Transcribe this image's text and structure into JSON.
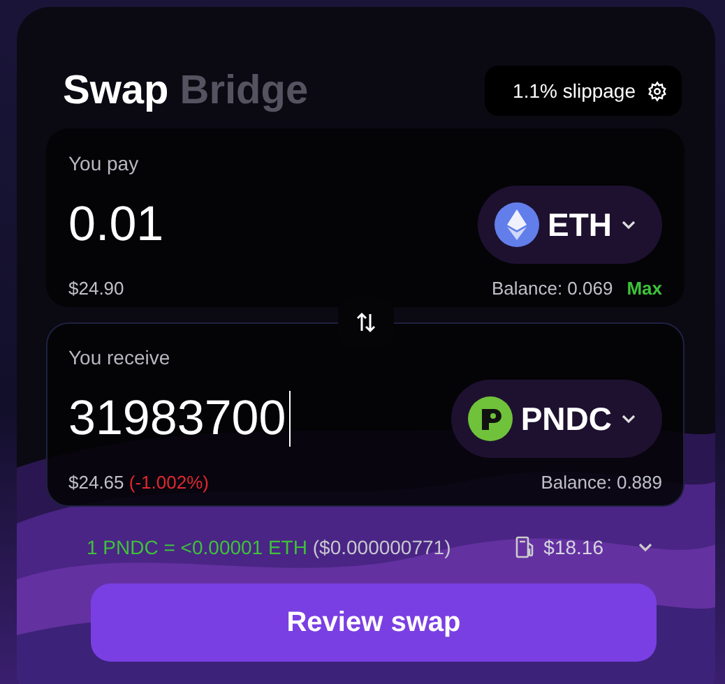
{
  "tabs": [
    {
      "label": "Swap",
      "selected": true
    },
    {
      "label": "Bridge",
      "selected": false
    }
  ],
  "slippage": {
    "label": "1.1% slippage"
  },
  "pay": {
    "label": "You pay",
    "amount": "0.01",
    "focused": false,
    "token": "ETH",
    "kind": "eth",
    "usd": "$24.90",
    "balance": "Balance: 0.069",
    "max": "Max"
  },
  "receive": {
    "label": "You receive",
    "amount": "31983700",
    "focused": true,
    "token": "PNDC",
    "kind": "pndc",
    "usd": "$24.65",
    "change": "(-1.002%)",
    "balance": "Balance: 0.889"
  },
  "rate": {
    "text": "1 PNDC = <0.00001 ETH",
    "usd": "($0.000000771)"
  },
  "gas": {
    "cost": "$18.16"
  },
  "button": "Review swap"
}
